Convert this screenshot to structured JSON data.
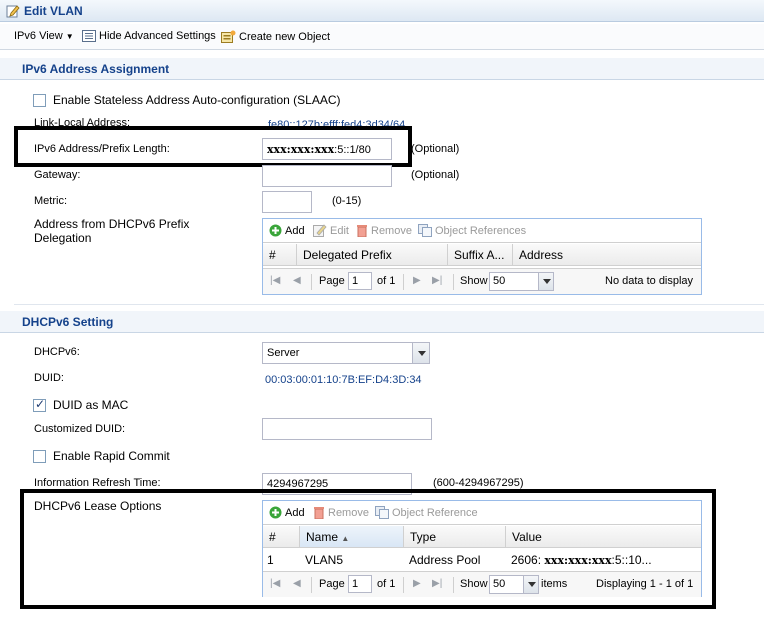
{
  "window": {
    "title": "Edit VLAN"
  },
  "toolbar": {
    "view_label": "IPv6 View",
    "advanced_label": "Hide Advanced Settings",
    "create_label": "Create new Object"
  },
  "ipv6": {
    "section_title": "IPv6 Address Assignment",
    "slaac_label": "Enable Stateless Address Auto-configuration (SLAAC)",
    "link_local_label": "Link-Local Address:",
    "link_local_value": "fe80::127b:efff:fed4:3d34/64",
    "prefix_label": "IPv6 Address/Prefix Length:",
    "prefix_value_masked": "xxx:xxx:xxx",
    "prefix_value_rest": ":5::1/80",
    "prefix_hint": "(Optional)",
    "gateway_label": "Gateway:",
    "gateway_hint": "(Optional)",
    "metric_label": "Metric:",
    "metric_hint": "(0-15)",
    "delegation_label_1": "Address from DHCPv6 Prefix",
    "delegation_label_2": "Delegation",
    "grid": {
      "add": "Add",
      "edit": "Edit",
      "remove": "Remove",
      "refs": "Object References",
      "headers": [
        "#",
        "Delegated Prefix",
        "Suffix A...",
        "Address"
      ],
      "page_label": "Page",
      "page_value": "1",
      "of_label": "of 1",
      "show_label": "Show",
      "show_value": "50",
      "status": "No data to display"
    }
  },
  "dhcp": {
    "section_title": "DHCPv6 Setting",
    "mode_label": "DHCPv6:",
    "mode_value": "Server",
    "duid_label": "DUID:",
    "duid_value": "00:03:00:01:10:7B:EF:D4:3D:34",
    "duid_mac_label": "DUID as MAC",
    "custom_duid_label": "Customized DUID:",
    "rapid_label": "Enable Rapid Commit",
    "refresh_label": "Information Refresh Time:",
    "refresh_value": "4294967295",
    "refresh_hint": "(600-4294967295)",
    "lease_label": "DHCPv6 Lease Options",
    "grid": {
      "add": "Add",
      "remove": "Remove",
      "refs": "Object Reference",
      "headers": [
        "#",
        "Name",
        "Type",
        "Value"
      ],
      "rows": [
        {
          "num": "1",
          "name": "VLAN5",
          "type": "Address Pool",
          "value_pre": "2606:",
          "value_masked": "xxx:xxx:xxx",
          "value_post": ":5::10..."
        }
      ],
      "page_label": "Page",
      "page_value": "1",
      "of_label": "of 1",
      "show_label": "Show",
      "show_value": "50",
      "items_label": "items",
      "status": "Displaying 1 - 1 of 1"
    }
  },
  "colors": {
    "accent": "#15428b",
    "border": "#99bbe8",
    "highlight": "#000000"
  },
  "icons": [
    "edit-icon",
    "view-dropdown-icon",
    "advanced-settings-icon",
    "create-object-icon",
    "add-icon",
    "edit-icon",
    "remove-icon",
    "object-references-icon",
    "first-page-icon",
    "prev-page-icon",
    "next-page-icon",
    "last-page-icon",
    "sort-asc-icon"
  ]
}
